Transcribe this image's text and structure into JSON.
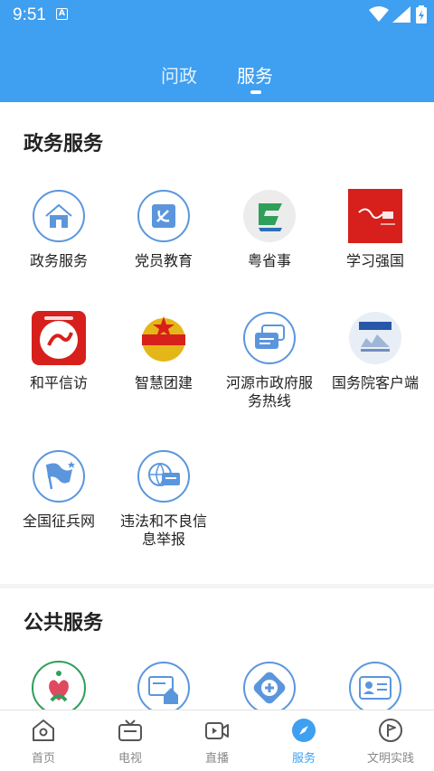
{
  "status_bar": {
    "time": "9:51",
    "notification_icon": "A"
  },
  "header_tabs": [
    {
      "label": "问政",
      "active": false
    },
    {
      "label": "服务",
      "active": true
    }
  ],
  "sections": {
    "gov": {
      "title": "政务服务",
      "items": [
        {
          "label": "政务服务",
          "icon": "house-icon"
        },
        {
          "label": "党员教育",
          "icon": "party-emblem-icon"
        },
        {
          "label": "粤省事",
          "icon": "yueshengshi-logo-icon"
        },
        {
          "label": "学习强国",
          "icon": "xuexiqiangguo-logo-icon"
        },
        {
          "label": "和平信访",
          "icon": "heping-xinfang-logo-icon"
        },
        {
          "label": "智慧团建",
          "icon": "youth-league-emblem-icon"
        },
        {
          "label": "河源市政府服务热线",
          "icon": "chat-bubbles-icon"
        },
        {
          "label": "国务院客户端",
          "icon": "state-council-logo-icon"
        },
        {
          "label": "全国征兵网",
          "icon": "flag-icon"
        },
        {
          "label": "违法和不良信息举报",
          "icon": "globe-report-icon"
        }
      ]
    },
    "public": {
      "title": "公共服务",
      "items": [
        {
          "label": "",
          "icon": "hospital-logo-icon"
        },
        {
          "label": "",
          "icon": "housing-fund-icon"
        },
        {
          "label": "",
          "icon": "medical-cross-icon"
        },
        {
          "label": "",
          "icon": "id-card-icon"
        }
      ]
    }
  },
  "bottom_nav": [
    {
      "label": "首页",
      "icon": "home-icon",
      "active": false
    },
    {
      "label": "电视",
      "icon": "tv-icon",
      "active": false
    },
    {
      "label": "直播",
      "icon": "live-video-icon",
      "active": false
    },
    {
      "label": "服务",
      "icon": "compass-icon",
      "active": true
    },
    {
      "label": "文明实践",
      "icon": "flag-circle-icon",
      "active": false
    }
  ],
  "colors": {
    "primary": "#3f9ff0",
    "icon_blue": "#5b96dd",
    "red": "#d7201b"
  }
}
